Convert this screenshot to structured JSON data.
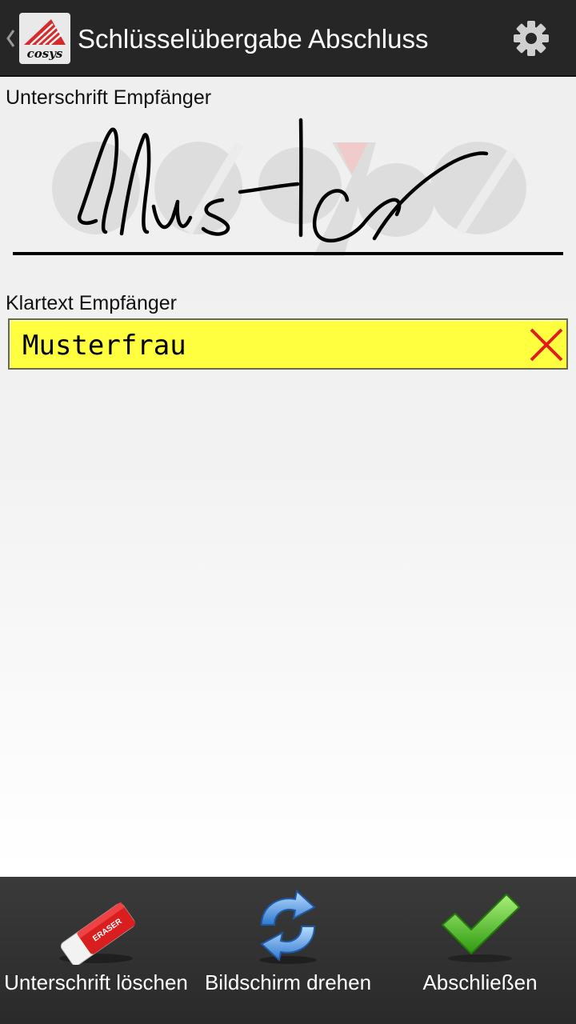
{
  "header": {
    "title": "Schlüsselübergabe Abschluss",
    "logo_text": "cosys"
  },
  "signature": {
    "label": "Unterschrift Empfänger",
    "signed_text": "Muster"
  },
  "clear_text": {
    "label": "Klartext Empfänger",
    "value": "Musterfrau"
  },
  "toolbar": {
    "delete_signature": "Unterschrift löschen",
    "rotate_screen": "Bildschirm drehen",
    "finish": "Abschließen",
    "eraser_text": "ERASER"
  },
  "colors": {
    "action_bar": "#262626",
    "field_background": "#ffff40",
    "clear_x": "#e21b1b",
    "check_green": "#3fbf1a"
  }
}
